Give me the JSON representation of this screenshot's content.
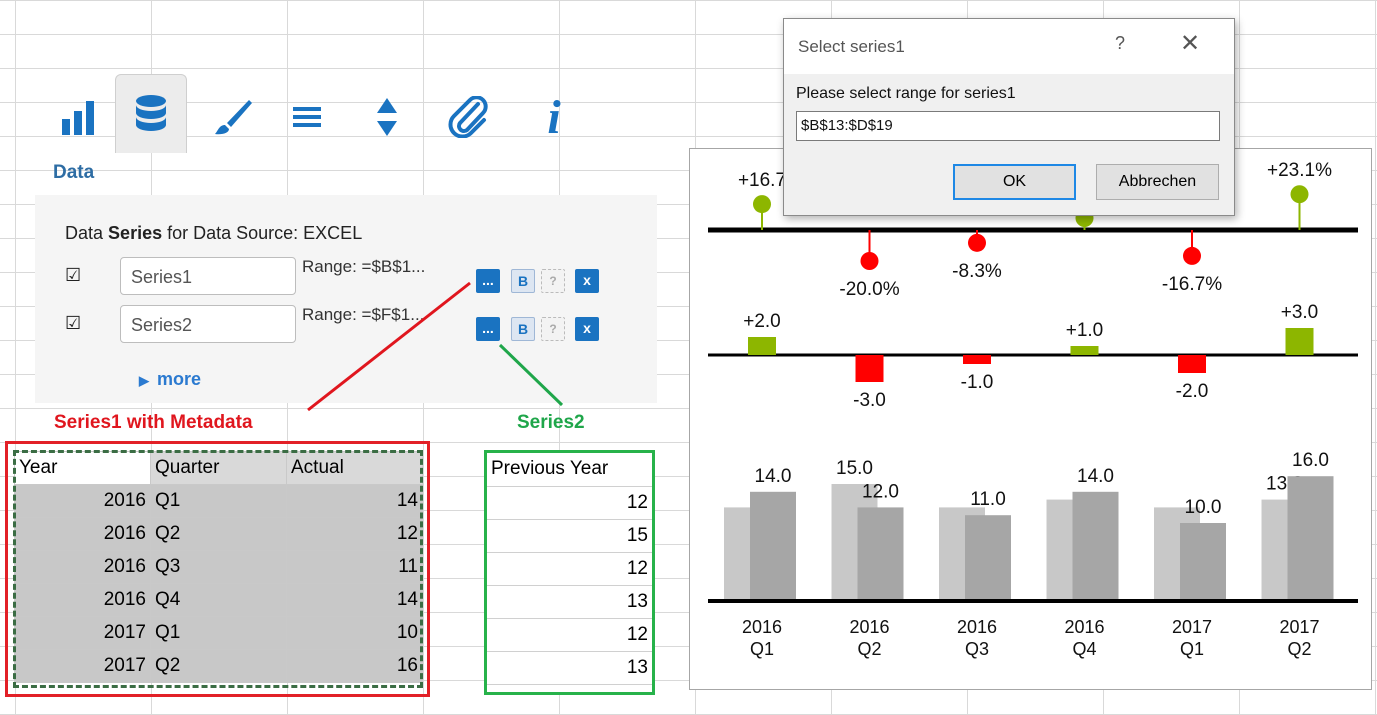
{
  "toolbar": {
    "icons": [
      "bar-chart-icon",
      "database-icon",
      "brush-icon",
      "menu-icon",
      "sort-icon",
      "paperclip-icon",
      "info-icon"
    ],
    "active": "database-icon"
  },
  "panel": {
    "title": "Data",
    "header_prefix": "Data",
    "header_bold": "Series",
    "header_suffix": "for Data Source: EXCEL",
    "series": [
      {
        "checked": true,
        "name": "Series1",
        "range": "Range: =$B$1..."
      },
      {
        "checked": true,
        "name": "Series2",
        "range": "Range: =$F$1..."
      }
    ],
    "dots_label": "...",
    "bold_label": "B",
    "help_label": "?",
    "delete_label": "x",
    "more_label": "more"
  },
  "annotations": {
    "series1": "Series1 with Metadata",
    "series2": "Series2"
  },
  "sheet": {
    "headers": [
      "Year",
      "Quarter",
      "Actual"
    ],
    "rows": [
      [
        "2016",
        "Q1",
        "14"
      ],
      [
        "2016",
        "Q2",
        "12"
      ],
      [
        "2016",
        "Q3",
        "11"
      ],
      [
        "2016",
        "Q4",
        "14"
      ],
      [
        "2017",
        "Q1",
        "10"
      ],
      [
        "2017",
        "Q2",
        "16"
      ]
    ],
    "prev_header": "Previous Year",
    "prev_values": [
      "12",
      "15",
      "12",
      "13",
      "12",
      "13"
    ]
  },
  "chart_data": {
    "type": "bar",
    "categories": [
      "2016\nQ1",
      "2016\nQ2",
      "2016\nQ3",
      "2016\nQ4",
      "2017\nQ1",
      "2017\nQ2"
    ],
    "series": [
      {
        "values": [
          12.0,
          15.0,
          12.0,
          13.0,
          12.0,
          13.0
        ]
      },
      {
        "values": [
          14.0,
          12.0,
          11.0,
          14.0,
          10.0,
          16.0
        ]
      }
    ],
    "value_labels_prev": [
      "",
      "15.0",
      "",
      "",
      "",
      "13.0"
    ],
    "value_labels_act": [
      "14.0",
      "12.0",
      "11.0",
      "14.0",
      "10.0",
      "16.0"
    ],
    "abs_variance": [
      2.0,
      -3.0,
      -1.0,
      1.0,
      -2.0,
      3.0
    ],
    "abs_variance_labels": [
      "+2.0",
      "-3.0",
      "-1.0",
      "+1.0",
      "-2.0",
      "+3.0"
    ],
    "rel_variance": [
      16.7,
      -20.0,
      -8.3,
      7.7,
      -16.7,
      23.1
    ],
    "rel_variance_labels": [
      "+16.7",
      "-20.0%",
      "-8.3%",
      "",
      "-16.7%",
      "+23.1%"
    ],
    "colors": {
      "prev": "#c8c8c8",
      "act": "#a6a6a6",
      "pos": "#8db600",
      "neg": "#ff0000"
    }
  },
  "dialog": {
    "title": "Select series1",
    "help": "?",
    "close": "✕",
    "prompt": "Please select range for series1",
    "value": "$B$13:$D$19",
    "ok": "OK",
    "cancel": "Abbrechen"
  }
}
